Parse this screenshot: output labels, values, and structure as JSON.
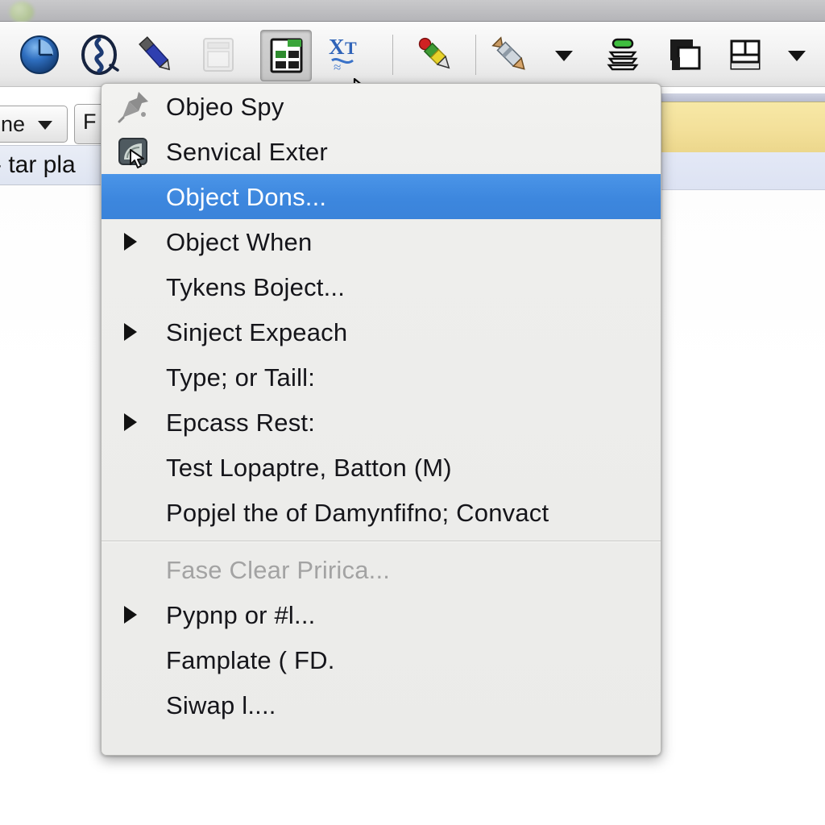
{
  "window": {
    "control_dot": "green-window-dot"
  },
  "toolbar": {
    "buttons": [
      {
        "name": "clock-pie-icon",
        "label": "Clock",
        "state": "normal"
      },
      {
        "name": "knot-symbol-icon",
        "label": "Knot",
        "state": "normal"
      },
      {
        "name": "blue-pen-icon",
        "label": "Blue Pen",
        "state": "normal"
      },
      {
        "name": "window-frame-icon",
        "label": "Window",
        "state": "disabled"
      },
      {
        "name": "grid-table-icon",
        "label": "Table",
        "state": "pressed"
      },
      {
        "name": "xt-transform-icon",
        "label": "X to T",
        "state": "normal"
      },
      {
        "name": "traffic-pencil-icon",
        "label": "Marker",
        "state": "normal"
      },
      {
        "name": "pencil-icon",
        "label": "Pencil",
        "state": "normal"
      },
      {
        "name": "stack-layers-icon",
        "label": "Layers",
        "state": "normal"
      },
      {
        "name": "window-overlap-icon",
        "label": "Overlap",
        "state": "normal"
      },
      {
        "name": "layout-split-icon",
        "label": "Layout",
        "state": "normal"
      }
    ],
    "dropdown_carets": 2
  },
  "background": {
    "combo_value": "ne",
    "f_button_label": "F",
    "strip_text": "- tar pla"
  },
  "context_menu": {
    "groups": [
      {
        "items": [
          {
            "label": "Objeo Spy",
            "icon": "pushpin-icon",
            "arrow": false,
            "selected": false,
            "disabled": false
          },
          {
            "label": "Senvical Exter",
            "icon": "screen-cursor-icon",
            "arrow": false,
            "selected": false,
            "disabled": false
          },
          {
            "label": "Object Dons...",
            "icon": null,
            "arrow": false,
            "selected": true,
            "disabled": false
          },
          {
            "label": "Object When",
            "icon": null,
            "arrow": true,
            "selected": false,
            "disabled": false
          },
          {
            "label": "Tykens Boject...",
            "icon": null,
            "arrow": false,
            "selected": false,
            "disabled": false
          },
          {
            "label": "Sinject Expeach",
            "icon": null,
            "arrow": true,
            "selected": false,
            "disabled": false
          },
          {
            "label": "Type; or Taill:",
            "icon": null,
            "arrow": false,
            "selected": false,
            "disabled": false
          },
          {
            "label": "Epcass Rest:",
            "icon": null,
            "arrow": true,
            "selected": false,
            "disabled": false
          },
          {
            "label": "Test Lopaptre, Batton (M)",
            "icon": null,
            "arrow": false,
            "selected": false,
            "disabled": false
          },
          {
            "label": "Popjel the of Damynfifno; Convact",
            "icon": null,
            "arrow": false,
            "selected": false,
            "disabled": false
          }
        ]
      },
      {
        "items": [
          {
            "label": "Fase Clear Pririca...",
            "icon": null,
            "arrow": false,
            "selected": false,
            "disabled": true
          },
          {
            "label": "Pypnp or #l...",
            "icon": null,
            "arrow": true,
            "selected": false,
            "disabled": false
          },
          {
            "label": "Famplate ( FD.",
            "icon": null,
            "arrow": false,
            "selected": false,
            "disabled": false
          },
          {
            "label": "Siwap l....",
            "icon": null,
            "arrow": false,
            "selected": false,
            "disabled": false
          }
        ]
      }
    ]
  },
  "colors": {
    "selection_blue": "#3d87de",
    "menu_background": "#eeeeec",
    "menu_text": "#15151a",
    "disabled_text": "#a3a3a3",
    "banner_yellow": "#f3e09a",
    "toolbar_background": "#f3f3f3"
  }
}
